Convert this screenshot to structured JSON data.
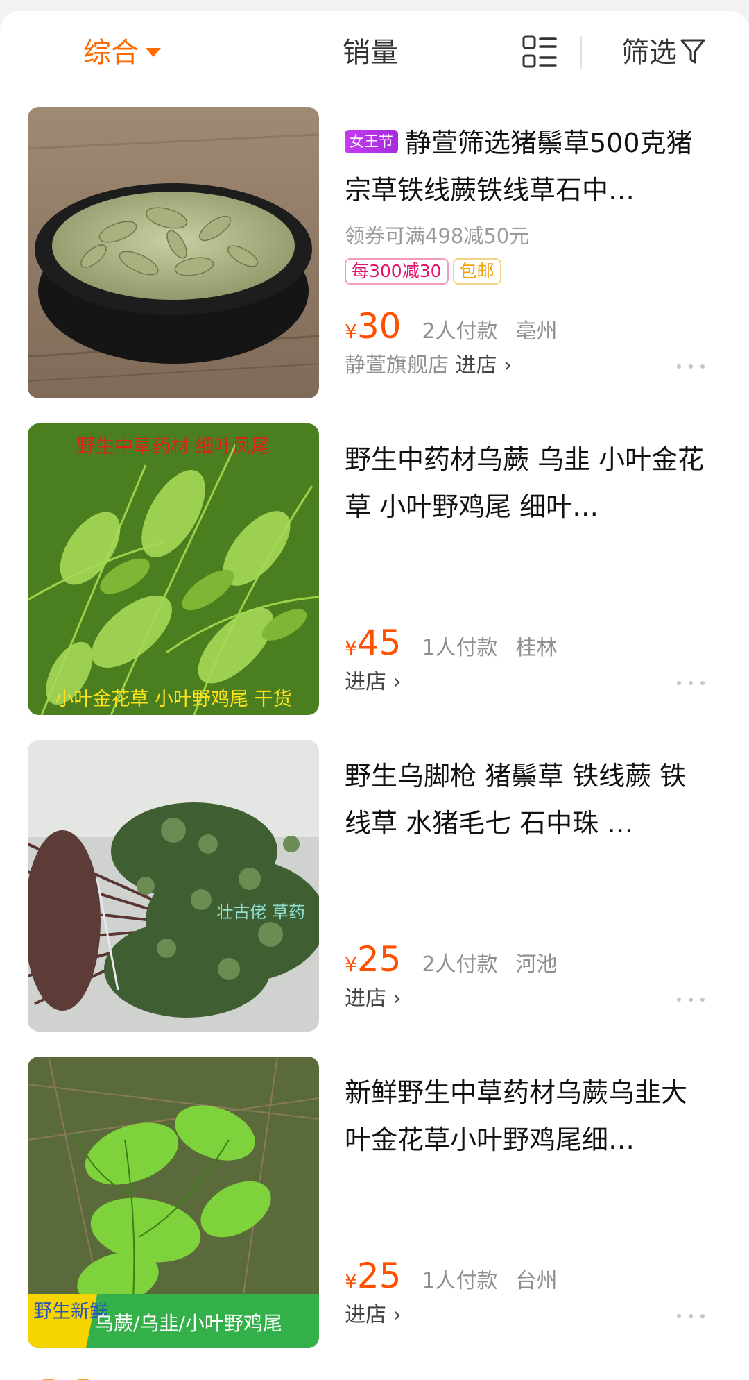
{
  "sortbar": {
    "comprehensive_label": "综合",
    "sales_label": "销量",
    "filter_label": "筛选",
    "active_color": "#ff6a00",
    "layout_icon": "grid-list-icon",
    "filter_icon": "funnel-icon"
  },
  "products": [
    {
      "event_badge": "女王节",
      "title": "静萱筛选猪鬃草500克猪宗草铁线蕨铁线草石中…",
      "coupon": "领券可满498减50元",
      "tag_discount": "每300减30",
      "tag_shipping": "包邮",
      "currency": "¥",
      "price": "30",
      "sales": "2人付款",
      "location": "亳州",
      "shop_name": "静萱旗舰店",
      "shop_link": "进店 ›"
    },
    {
      "title": "野生中药材乌蕨 乌韭 小叶金花草 小叶野鸡尾 细叶…",
      "image_caption_top": "野生中草药材 细叶凤尾",
      "image_caption_bottom": "小叶金花草 小叶野鸡尾 干货",
      "currency": "¥",
      "price": "45",
      "sales": "1人付款",
      "location": "桂林",
      "shop_link": "进店 ›"
    },
    {
      "title": "野生乌脚枪 猪鬃草 铁线蕨 铁线草 水猪毛七 石中珠 …",
      "image_watermark": "壮古佬 草药",
      "currency": "¥",
      "price": "25",
      "sales": "2人付款",
      "location": "河池",
      "shop_link": "进店 ›"
    },
    {
      "title": "新鲜野生中草药材乌蕨乌韭大叶金花草小叶野鸡尾细…",
      "image_badge": "野生新鲜",
      "image_banner": "乌蕨/乌韭/小叶野鸡尾",
      "currency": "¥",
      "price": "25",
      "sales": "1人付款",
      "location": "台州",
      "shop_link": "进店 ›"
    }
  ]
}
